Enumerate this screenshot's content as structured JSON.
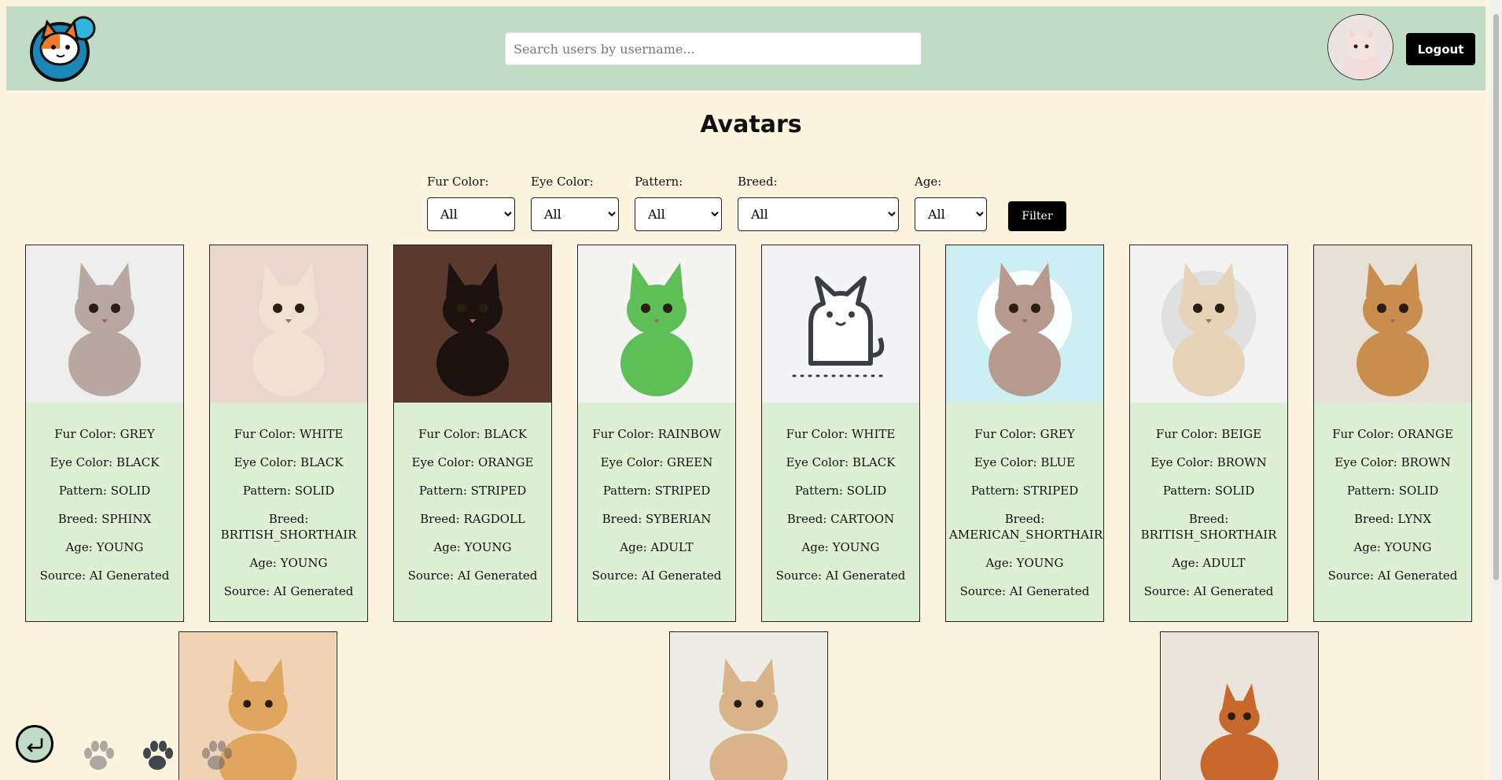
{
  "header": {
    "search_placeholder": "Search users by username...",
    "logout_label": "Logout"
  },
  "page_title": "Avatars",
  "filters": {
    "fur_color": {
      "label": "Fur Color:",
      "value": "All"
    },
    "eye_color": {
      "label": "Eye Color:",
      "value": "All"
    },
    "pattern": {
      "label": "Pattern:",
      "value": "All"
    },
    "breed": {
      "label": "Breed:",
      "value": "All"
    },
    "age": {
      "label": "Age:",
      "value": "All"
    },
    "button_label": "Filter"
  },
  "cards": [
    {
      "fur": "Fur Color: GREY",
      "eye": "Eye Color: BLACK",
      "pattern": "Pattern: SOLID",
      "breed": "Breed: SPHINX",
      "age": "Age: YOUNG",
      "source": "Source: AI Generated",
      "bg": "#eeeeee",
      "cat": "#b7a9a2"
    },
    {
      "fur": "Fur Color: WHITE",
      "eye": "Eye Color: BLACK",
      "pattern": "Pattern: SOLID",
      "breed": "Breed: BRITISH_SHORTHAIR",
      "age": "Age: YOUNG",
      "source": "Source: AI Generated",
      "bg": "#e8d6cf",
      "cat": "#f1e1d2"
    },
    {
      "fur": "Fur Color: BLACK",
      "eye": "Eye Color: ORANGE",
      "pattern": "Pattern: STRIPED",
      "breed": "Breed: RAGDOLL",
      "age": "Age: YOUNG",
      "source": "Source: AI Generated",
      "bg": "#5a3a2c",
      "cat": "#1b1210"
    },
    {
      "fur": "Fur Color: RAINBOW",
      "eye": "Eye Color: GREEN",
      "pattern": "Pattern: STRIPED",
      "breed": "Breed: SYBERIAN",
      "age": "Age: ADULT",
      "source": "Source: AI Generated",
      "bg": "#f4f4f2",
      "cat": "#5fbf57"
    },
    {
      "fur": "Fur Color: WHITE",
      "eye": "Eye Color: BLACK",
      "pattern": "Pattern: SOLID",
      "breed": "Breed: CARTOON",
      "age": "Age: YOUNG",
      "source": "Source: AI Generated",
      "bg": "#f4f4f6",
      "cat": "#ffffff"
    },
    {
      "fur": "Fur Color: GREY",
      "eye": "Eye Color: BLUE",
      "pattern": "Pattern: STRIPED",
      "breed": "Breed:\nAMERICAN_SHORTHAIR",
      "age": "Age: YOUNG",
      "source": "Source: AI Generated",
      "bg": "#cdeef2",
      "cat": "#b79a8e"
    },
    {
      "fur": "Fur Color: BEIGE",
      "eye": "Eye Color: BROWN",
      "pattern": "Pattern: SOLID",
      "breed": "Breed: BRITISH_SHORTHAIR",
      "age": "Age: ADULT",
      "source": "Source: AI Generated",
      "bg": "#f2f2f2",
      "cat": "#e6d3b8"
    },
    {
      "fur": "Fur Color: ORANGE",
      "eye": "Eye Color: BROWN",
      "pattern": "Pattern: SOLID",
      "breed": "Breed: LYNX",
      "age": "Age: YOUNG",
      "source": "Source: AI Generated",
      "bg": "#e7e0d6",
      "cat": "#c98e4e"
    }
  ],
  "partial_cards": [
    {
      "bg": "#f0d3b4",
      "cat": "#e0a660"
    },
    {
      "bg": "#eeece6",
      "cat": "#d9b48a"
    },
    {
      "bg": "#e9e4dc",
      "cat": "#c8682c"
    }
  ]
}
